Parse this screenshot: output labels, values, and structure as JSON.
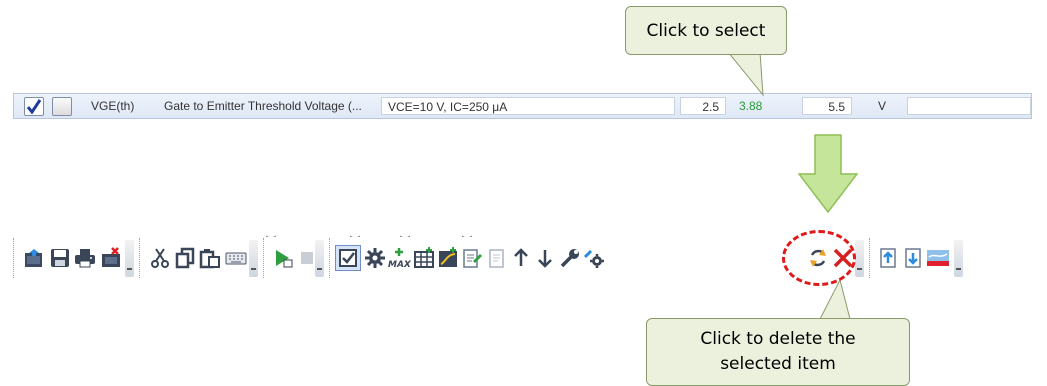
{
  "callouts": {
    "select": "Click to select",
    "delete_line1": "Click to delete the",
    "delete_line2": "selected item"
  },
  "row": {
    "enabled_checked": true,
    "symbol": "VGE(th)",
    "description": "Gate to Emitter Threshold Voltage (...",
    "condition": "VCE=10 V, IC=250 μA",
    "min": "2.5",
    "measured": "3.88",
    "max": "5.5",
    "unit": "V"
  },
  "toolbar": {
    "icons": [
      "open-icon",
      "save-icon",
      "print-icon",
      "close-file-icon",
      "cut-icon",
      "copy-icon",
      "paste-icon",
      "keyboard-icon",
      "run-icon",
      "stop-icon",
      "select-checkbox-icon",
      "settings-icon",
      "add-max-icon",
      "add-table-icon",
      "add-chart-icon",
      "edit-doc-icon",
      "blank-doc-icon",
      "move-up-icon",
      "move-down-icon",
      "wrench-icon",
      "gear-tool-icon",
      "refresh-icon",
      "delete-icon",
      "upload-icon",
      "download-icon",
      "flag-icon"
    ]
  },
  "colors": {
    "callout_fill": "#ebf1dd",
    "highlight": "#e01a1a",
    "measured_value": "#2a9a3a",
    "arrow_fill": "#c4e59a"
  }
}
